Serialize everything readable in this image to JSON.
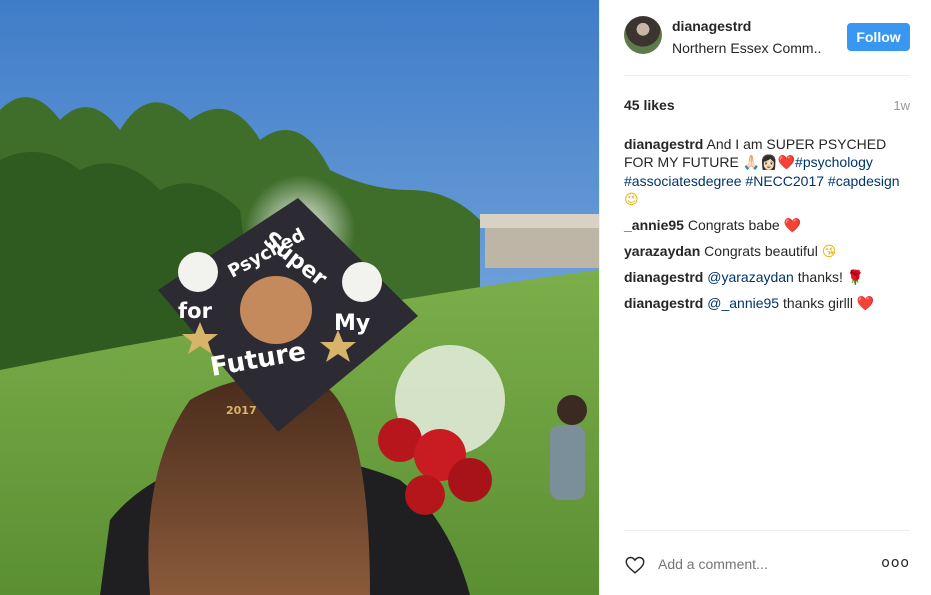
{
  "post": {
    "username": "dianagestrd",
    "location": "Northern Essex Comm..",
    "follow_label": "Follow",
    "likes": "45 likes",
    "time": "1w",
    "cap_text": {
      "line1": "Super",
      "line2": "Psyched",
      "left": "for",
      "right": "My",
      "bottom": "Future",
      "year": "2017"
    }
  },
  "caption": {
    "user": "dianagestrd",
    "text": "And I am SUPER PSYCHED FOR MY FUTURE",
    "emojis": "🙏🏻👩🏻❤️",
    "tags": [
      "#psychology",
      "#associatesdegree",
      "#NECC2017",
      "#capdesign"
    ],
    "end_emoji": "😉"
  },
  "comments": [
    {
      "user": "_annie95",
      "text": "Congrats babe",
      "emoji": "❤️",
      "emoji_type": "heart"
    },
    {
      "user": "yarazaydan",
      "text": "Congrats beautiful",
      "emoji": "😘",
      "emoji_type": "wink"
    },
    {
      "user": "dianagestrd",
      "mention": "@yarazaydan",
      "text": "thanks!",
      "emoji": "🌹",
      "emoji_type": "rose"
    },
    {
      "user": "dianagestrd",
      "mention": "@_annie95",
      "text": "thanks girlll",
      "emoji": "❤️",
      "emoji_type": "heart"
    }
  ],
  "footer": {
    "add_comment_placeholder": "Add a comment...",
    "more_icon": "ooo",
    "like_icon": "heart-outline-icon"
  },
  "colors": {
    "follow_bg": "#3897f0",
    "hashtag": "#003569",
    "muted": "#999999"
  }
}
